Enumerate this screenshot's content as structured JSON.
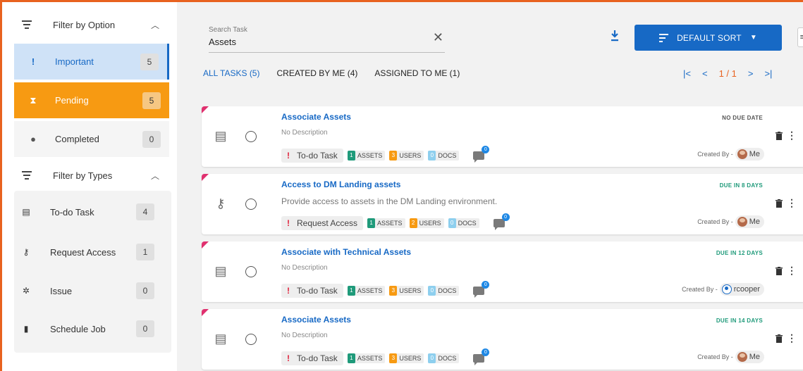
{
  "sidebar": {
    "filter_option": {
      "title": "Filter by Option",
      "items": [
        {
          "label": "Important",
          "count": "5",
          "icon": "exclamation-icon"
        },
        {
          "label": "Pending",
          "count": "5",
          "icon": "hourglass-icon"
        },
        {
          "label": "Completed",
          "count": "0",
          "icon": "check-circle-icon"
        }
      ]
    },
    "filter_types": {
      "title": "Filter by Types",
      "items": [
        {
          "label": "To-do Task",
          "count": "4",
          "icon": "list-icon"
        },
        {
          "label": "Request Access",
          "count": "1",
          "icon": "key-icon"
        },
        {
          "label": "Issue",
          "count": "0",
          "icon": "bug-icon"
        },
        {
          "label": "Schedule Job",
          "count": "0",
          "icon": "book-icon"
        }
      ]
    }
  },
  "search": {
    "placeholder": "Search Task",
    "value": "Assets"
  },
  "sort_button": {
    "label": "DEFAULT SORT"
  },
  "tabs": [
    "ALL TASKS (5)",
    "CREATED BY ME (4)",
    "ASSIGNED TO ME (1)"
  ],
  "pager": {
    "page": "1 / 1"
  },
  "labels": {
    "assets": "ASSETS",
    "users": "USERS",
    "docs": "DOCS",
    "created_by": "Created By -"
  },
  "colors": {
    "accent": "#1769c5",
    "pending": "#f79a12",
    "important_bg": "#cfe2f7",
    "due_green": "#1f9a7a",
    "border": "#e8621f"
  },
  "tasks": [
    {
      "title": "Associate Assets",
      "description": "No Description",
      "type": "To-do Task",
      "assets": "1",
      "users": "3",
      "docs": "0",
      "comments": "0",
      "due": "NO DUE DATE",
      "creator": "Me"
    },
    {
      "title": "Access to DM Landing assets",
      "description": "Provide access to assets in the DM Landing environment.",
      "type": "Request Access",
      "assets": "1",
      "users": "2",
      "docs": "0",
      "comments": "0",
      "due": "DUE IN 8 DAYS",
      "creator": "Me"
    },
    {
      "title": "Associate with Technical Assets",
      "description": "No Description",
      "type": "To-do Task",
      "assets": "1",
      "users": "3",
      "docs": "0",
      "comments": "0",
      "due": "DUE IN 12 DAYS",
      "creator": "rcooper"
    },
    {
      "title": "Associate Assets",
      "description": "No Description",
      "type": "To-do Task",
      "assets": "1",
      "users": "3",
      "docs": "0",
      "comments": "0",
      "due": "DUE IN 14 DAYS",
      "creator": "Me"
    }
  ]
}
